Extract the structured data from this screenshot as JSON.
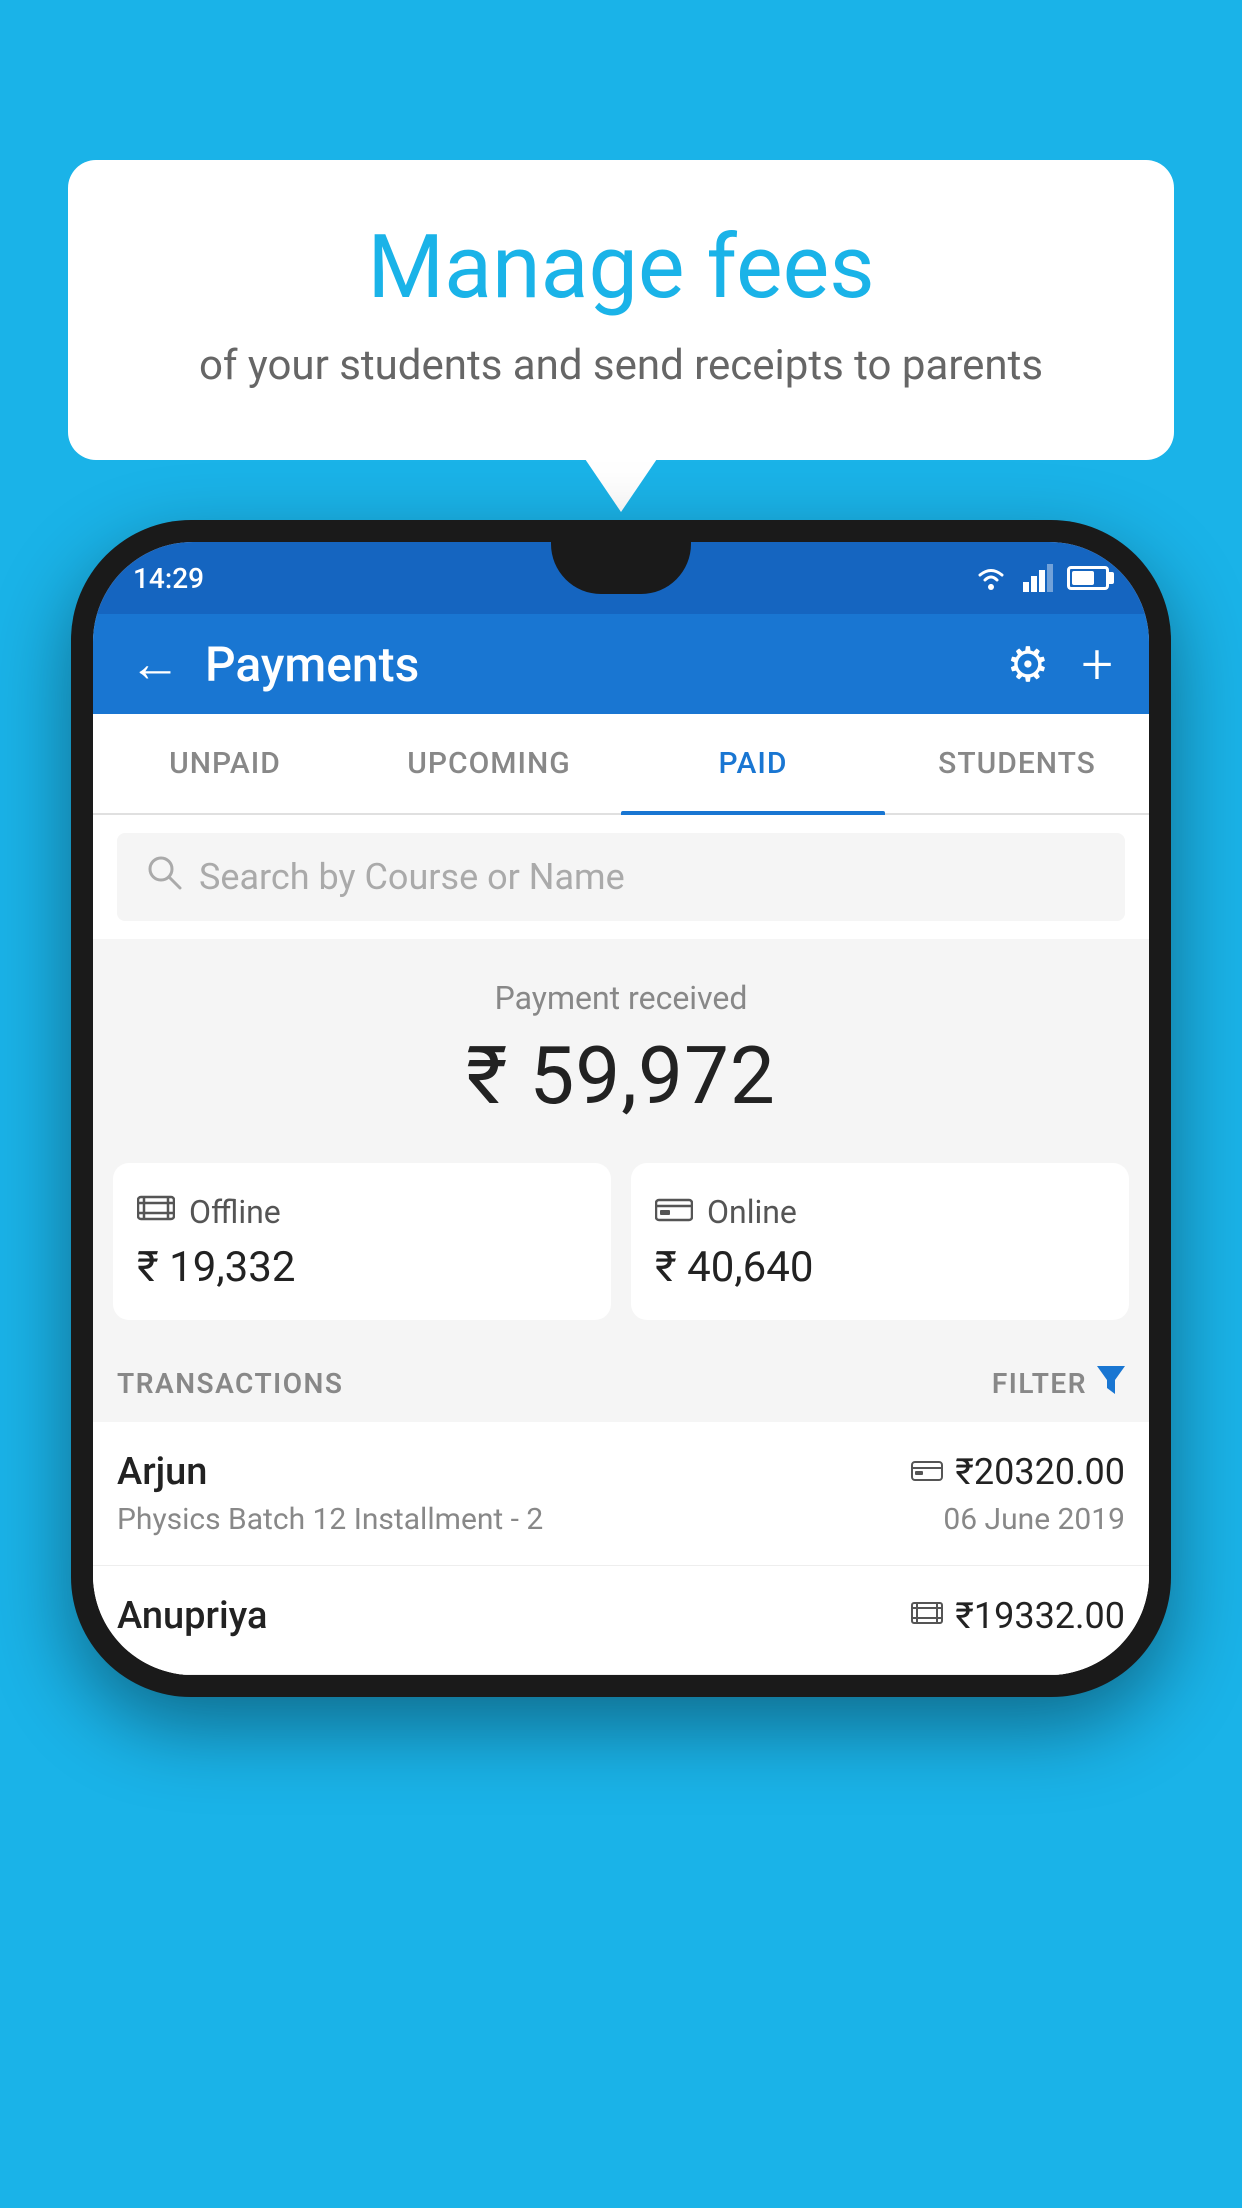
{
  "background_color": "#1ab3e8",
  "bubble": {
    "title": "Manage fees",
    "subtitle": "of your students and send receipts to parents"
  },
  "status_bar": {
    "time": "14:29"
  },
  "header": {
    "title": "Payments",
    "back_label": "←",
    "gear_label": "⚙",
    "plus_label": "+"
  },
  "tabs": [
    {
      "label": "UNPAID",
      "active": false
    },
    {
      "label": "UPCOMING",
      "active": false
    },
    {
      "label": "PAID",
      "active": true
    },
    {
      "label": "STUDENTS",
      "active": false
    }
  ],
  "search": {
    "placeholder": "Search by Course or Name"
  },
  "payment_summary": {
    "label": "Payment received",
    "amount": "₹ 59,972"
  },
  "payment_cards": [
    {
      "icon": "💳",
      "label": "Offline",
      "amount": "₹ 19,332"
    },
    {
      "icon": "💳",
      "label": "Online",
      "amount": "₹ 40,640"
    }
  ],
  "transactions_label": "TRANSACTIONS",
  "filter_label": "FILTER",
  "transactions": [
    {
      "name": "Arjun",
      "course": "Physics Batch 12 Installment - 2",
      "amount": "₹20320.00",
      "date": "06 June 2019",
      "icon_type": "card"
    },
    {
      "name": "Anupriya",
      "course": "",
      "amount": "₹19332.00",
      "date": "",
      "icon_type": "cash"
    }
  ]
}
